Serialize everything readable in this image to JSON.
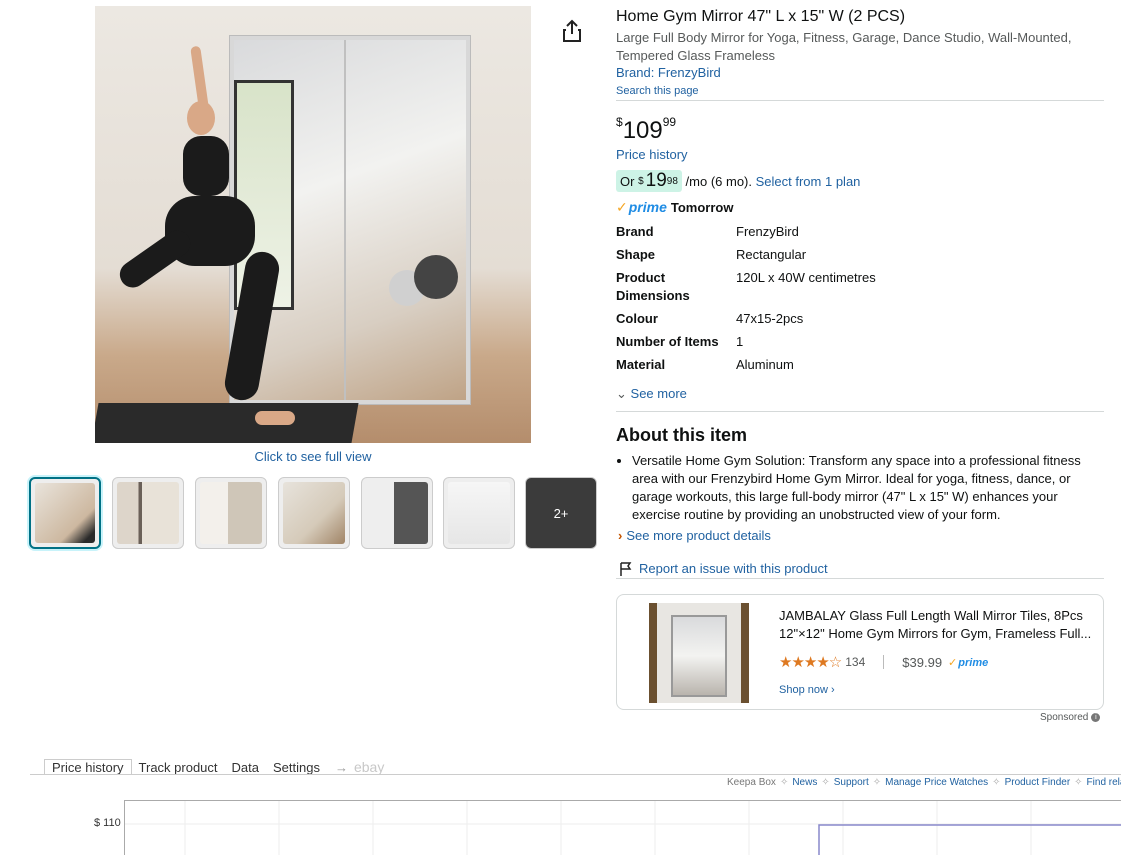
{
  "gallery": {
    "click_full": "Click to see full view",
    "more_label": "2+"
  },
  "product": {
    "title": "Home Gym Mirror 47\" L x 15\" W (2 PCS)",
    "subtitle": "Large Full Body Mirror for Yoga, Fitness, Garage, Dance Studio, Wall-Mounted, Tempered Glass Frameless",
    "brand_link": "Brand: FrenzyBird",
    "search_page": "Search this page",
    "price": {
      "symbol": "$",
      "whole": "109",
      "fraction": "99"
    },
    "price_history": "Price history",
    "installment": {
      "prefix": "Or",
      "symbol": "$",
      "whole": "19",
      "fraction": "98",
      "suffix": "/mo (6 mo).",
      "link": "Select from 1 plan"
    },
    "prime": {
      "word": "prime",
      "delivery": "Tomorrow"
    },
    "specs": [
      {
        "key": "Brand",
        "value": "FrenzyBird"
      },
      {
        "key": "Shape",
        "value": "Rectangular"
      },
      {
        "key": "Product Dimensions",
        "value": "120L x 40W centimetres"
      },
      {
        "key": "Colour",
        "value": "47x15-2pcs"
      },
      {
        "key": "Number of Items",
        "value": "1"
      },
      {
        "key": "Material",
        "value": "Aluminum"
      }
    ],
    "see_more": "See more",
    "about_title": "About this item",
    "about_bullet": "Versatile Home Gym Solution: Transform any space into a professional fitness area with our Frenzybird Home Gym Mirror. Ideal for yoga, fitness, dance, or garage workouts, this large full-body mirror (47\" L x 15\" W) enhances your exercise routine by providing an unobstructed view of your form.",
    "more_details": "See more product details",
    "report": "Report an issue with this product"
  },
  "sponsored": {
    "title": "JAMBALAY Glass Full Length Wall Mirror Tiles, 8Pcs 12\"×12\" Home Gym Mirrors for Gym, Frameless Full...",
    "stars": "★★★★☆",
    "rating_count": "134",
    "price": "$39.99",
    "prime": "prime",
    "shop_now": "Shop now ›",
    "label": "Sponsored"
  },
  "keepa": {
    "tabs": [
      "Price history",
      "Track product",
      "Data",
      "Settings"
    ],
    "arrow": "→",
    "ebay": "ebay",
    "links": [
      "Keepa Box",
      "News",
      "Support",
      "Manage Price Watches",
      "Product Finder",
      "Find rela"
    ],
    "y_label": "$ 110"
  },
  "colors": {
    "link": "#2162a1",
    "installment_bg": "#cdf3e6",
    "prime_blue": "#1f8ce4",
    "star": "#de7921",
    "chart_line": "#8888cc"
  }
}
